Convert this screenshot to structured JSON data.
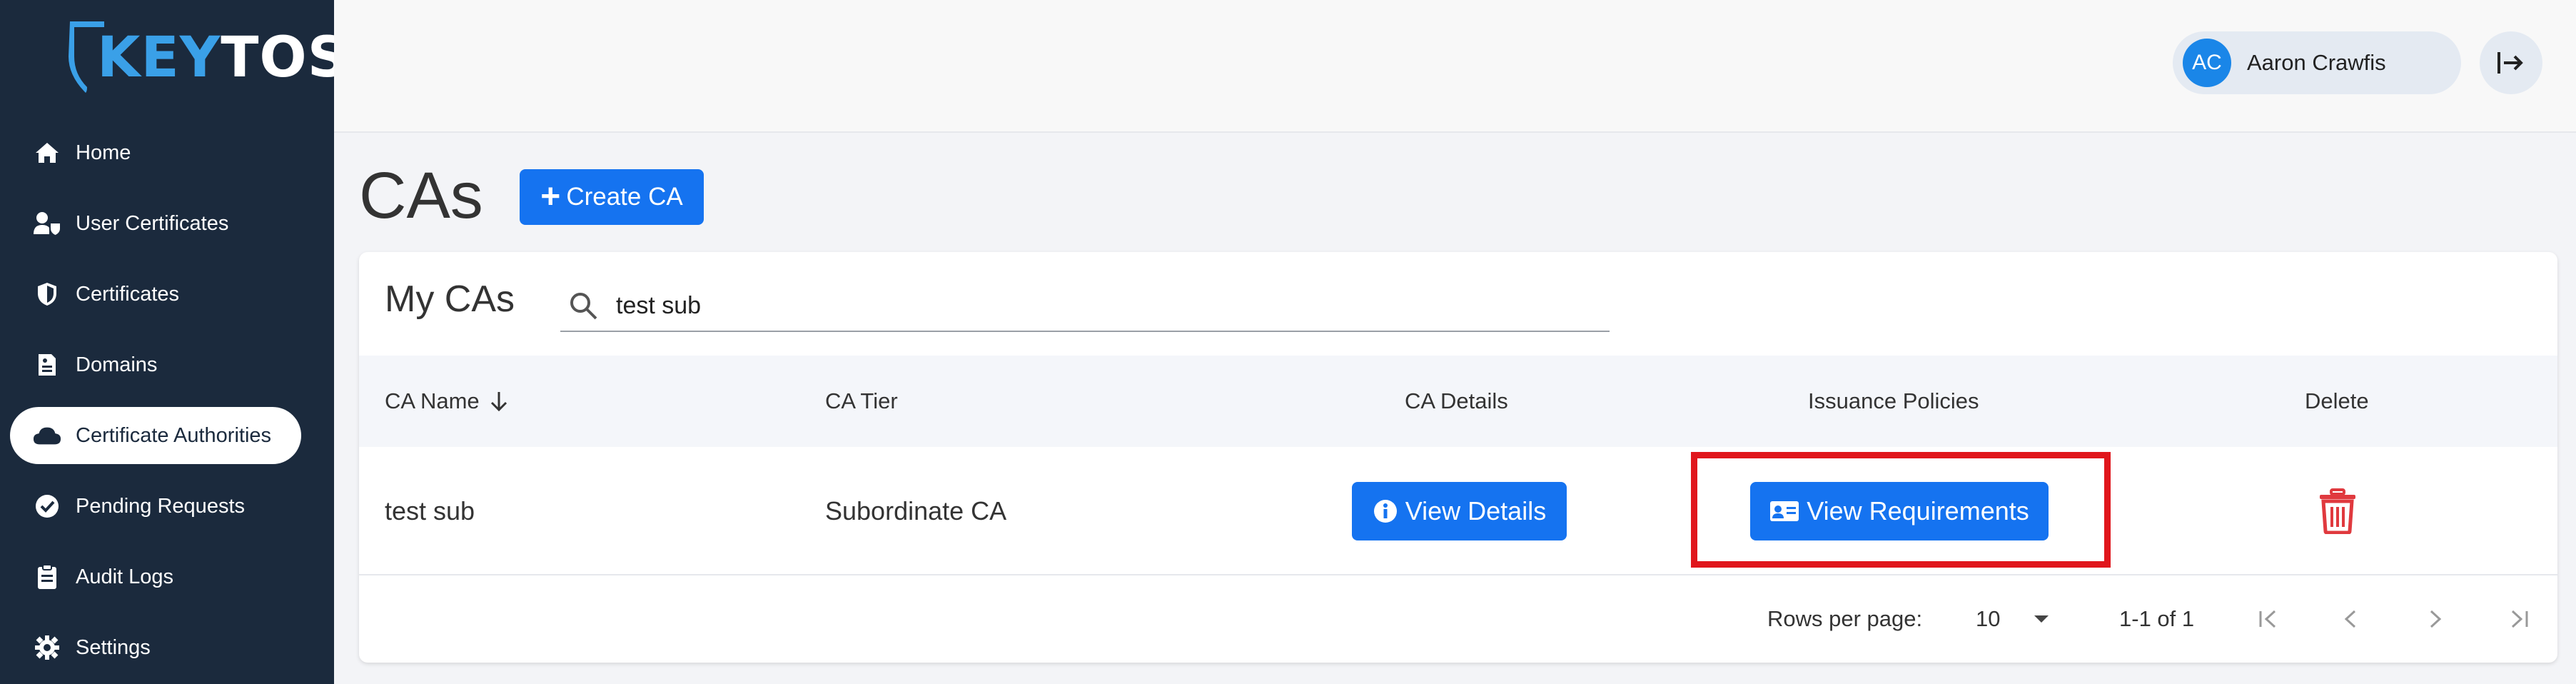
{
  "app": {
    "logo_text_key": "KEY",
    "logo_text_tos": "TOS"
  },
  "sidebar": {
    "items": [
      {
        "label": "Home",
        "icon": "home-icon"
      },
      {
        "label": "User Certificates",
        "icon": "user-shield-icon"
      },
      {
        "label": "Certificates",
        "icon": "shield-icon"
      },
      {
        "label": "Domains",
        "icon": "domain-icon"
      },
      {
        "label": "Certificate Authorities",
        "icon": "cloud-icon",
        "active": true
      },
      {
        "label": "Pending Requests",
        "icon": "check-circle-icon"
      },
      {
        "label": "Audit Logs",
        "icon": "clipboard-icon"
      },
      {
        "label": "Settings",
        "icon": "gear-icon"
      }
    ]
  },
  "header": {
    "user": {
      "initials": "AC",
      "name": "Aaron Crawfis"
    }
  },
  "page": {
    "title": "CAs",
    "create_button": "Create CA"
  },
  "card": {
    "title": "My CAs",
    "search": {
      "value": "test sub"
    },
    "columns": [
      "CA Name",
      "CA Tier",
      "CA Details",
      "Issuance Policies",
      "Delete"
    ],
    "rows": [
      {
        "ca_name": "test sub",
        "ca_tier": "Subordinate CA",
        "details_button": "View Details",
        "policies_button": "View Requirements"
      }
    ],
    "pagination": {
      "rows_per_page_label": "Rows per page:",
      "rows_per_page": "10",
      "range": "1-1 of 1"
    }
  },
  "colors": {
    "sidebar_bg": "#1b2a3d",
    "accent": "#1573f0",
    "highlight": "#e0161c",
    "delete": "#e0393e"
  }
}
